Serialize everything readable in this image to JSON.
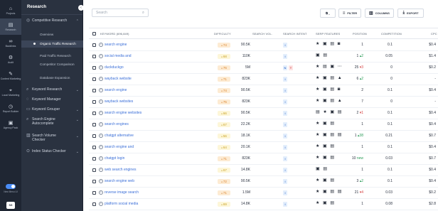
{
  "rail": [
    {
      "icon": "home-icon",
      "glyph": "⌂",
      "label": "Projects"
    },
    {
      "icon": "research-icon",
      "glyph": "▤",
      "label": "Research"
    },
    {
      "icon": "backlinks-icon",
      "glyph": "∞",
      "label": "Backlinks"
    },
    {
      "icon": "audit-icon",
      "glyph": "⚙",
      "label": "Audit"
    },
    {
      "icon": "content-icon",
      "glyph": "✎",
      "label": "Content Marketing"
    },
    {
      "icon": "local-icon",
      "glyph": "⌖",
      "label": "Local Marketing"
    },
    {
      "icon": "report-icon",
      "glyph": "◷",
      "label": "Report Builder"
    },
    {
      "icon": "agency-icon",
      "glyph": "▣",
      "label": "Agency Pack"
    }
  ],
  "rail_footer": {
    "toggle_label": "New Menu UI",
    "avatar": "SG"
  },
  "panel": {
    "title": "Research",
    "collapse_glyph": "‹",
    "sections": [
      {
        "label": "Competitive Research",
        "icon": "◎",
        "caret": "⌃"
      },
      {
        "label": "Keyword Research",
        "icon": "⌕",
        "caret": "⌄"
      },
      {
        "label": "Keyword Manager",
        "icon": "◌",
        "caret": ""
      },
      {
        "label": "Keyword Grouper",
        "icon": "▭",
        "caret": "⌄"
      },
      {
        "label": "Search Engine Autocomplete",
        "icon": "⌕",
        "caret": "⌄"
      },
      {
        "label": "Search Volume Checker",
        "icon": "▥",
        "caret": "⌄"
      },
      {
        "label": "Index Status Checker",
        "icon": "⊙",
        "caret": "⌄"
      }
    ],
    "sub_items": [
      "Overview",
      "Organic Traffic Research",
      "Paid Traffic Research",
      "Competitor Comparison",
      "Database Expansion"
    ]
  },
  "toolbar": {
    "search_placeholder": "Search",
    "filter_label": "FILTER",
    "columns_label": "COLUMNS",
    "export_label": "EXPORT",
    "copy_glyph": "⧉ ⌄"
  },
  "table": {
    "headers": {
      "keyword": "KEYWORD (696,849)",
      "difficulty": "DIFFICULTY",
      "search_vol": "SEARCH VOL.",
      "intent": "SEARCH INTENT",
      "serp": "SERP FEATURES",
      "position": "POSITION",
      "competition": "COMPETITION",
      "cpc": "CPC"
    },
    "rows": [
      {
        "keyword": "search engine",
        "difficulty": "74",
        "vol": "90.5K",
        "intents": [
          "I"
        ],
        "serp": "★ ▣ ▤ ◙",
        "position": "1",
        "competition": "0.1",
        "cpc": "$0.4"
      },
      {
        "keyword": "social media and",
        "difficulty": "68",
        "vol": "110K",
        "intents": [
          "I"
        ],
        "serp": "▣ ▤",
        "position": "1 ▴2",
        "competition": "0.05",
        "cpc": "$1.4"
      },
      {
        "keyword": "duckduckgo",
        "difficulty": "76",
        "vol": "5M",
        "intents": [
          "N",
          "T"
        ],
        "serp": "★ ▤ ▣ ⋯",
        "position": "25 ▾3",
        "competition": "0",
        "cpc": "$0.2"
      },
      {
        "keyword": "wayback website",
        "difficulty": "71",
        "vol": "823K",
        "intents": [
          "I"
        ],
        "serp": "★ ▣ ▤ ▲",
        "position": "6 ▴2",
        "competition": "0",
        "cpc": "-"
      },
      {
        "keyword": "search engine",
        "difficulty": "74",
        "vol": "90.5K",
        "intents": [
          "I"
        ],
        "serp": "★ ▣ ▤ ◙",
        "position": "2",
        "competition": "0.1",
        "cpc": "$0.4"
      },
      {
        "keyword": "wayback websites",
        "difficulty": "75",
        "vol": "823K",
        "intents": [
          "I"
        ],
        "serp": "★ ▣ ▤ ▲",
        "position": "7",
        "competition": "0",
        "cpc": "-"
      },
      {
        "keyword": "search engine websites",
        "difficulty": "66",
        "vol": "90.5K",
        "intents": [
          "I"
        ],
        "serp": "▤ ★ ▣ ▤",
        "position": "2 ▾1",
        "competition": "0.1",
        "cpc": "$0.4"
      },
      {
        "keyword": "search engines",
        "difficulty": "67",
        "vol": "22.2K",
        "intents": [
          "I"
        ],
        "serp": "★ ▣ ▤",
        "position": "1",
        "competition": "0.1",
        "cpc": "$0.4"
      },
      {
        "keyword": "chatgpt alternative",
        "difficulty": "56",
        "vol": "18.1K",
        "intents": [
          "I"
        ],
        "serp": "★ ▣ ▤ ▤",
        "position": "1 ▴38",
        "competition": "0.21",
        "cpc": "$0.7"
      },
      {
        "keyword": "search engine and",
        "difficulty": "64",
        "vol": "20.1K",
        "intents": [
          "I"
        ],
        "serp": "★ ▣ ▤",
        "position": "1",
        "competition": "0.1",
        "cpc": "$0.4"
      },
      {
        "keyword": "chatgpt login",
        "difficulty": "71",
        "vol": "823K",
        "intents": [
          "I"
        ],
        "serp": "★ ▣ ▤",
        "position": "10 new",
        "competition": "0.03",
        "cpc": "$0.7"
      },
      {
        "keyword": "web search engines",
        "difficulty": "67",
        "vol": "14.8K",
        "intents": [
          "I"
        ],
        "serp": "▣ ▤",
        "position": "1",
        "competition": "0.1",
        "cpc": "$0.4"
      },
      {
        "keyword": "search engine web",
        "difficulty": "72",
        "vol": "90.5K",
        "intents": [
          "I"
        ],
        "serp": "★ ▣ ▤",
        "position": "3 ▴2",
        "competition": "0.1",
        "cpc": "$0.4"
      },
      {
        "keyword": "reverse image search",
        "difficulty": "71",
        "vol": "1.5M",
        "intents": [
          "I"
        ],
        "serp": "★ ▣ ▤ ▤",
        "position": "21 ▾4",
        "competition": "0.03",
        "cpc": "$0.2"
      },
      {
        "keyword": "platform social media",
        "difficulty": "69",
        "vol": "14.8K",
        "intents": [
          "I"
        ],
        "serp": "★ ▣ ▤",
        "position": "1",
        "competition": "0.08",
        "cpc": "$2.8"
      }
    ]
  },
  "colors": {
    "diff_orange_bg": "#fdebd3",
    "diff_orange_fg": "#d9822b",
    "diff_yellow_bg": "#fdf6d8",
    "diff_yellow_fg": "#c9a227",
    "intent_i_bg": "#e3eefc",
    "intent_i_fg": "#4a7bd0",
    "intent_t_bg": "#fde4e4",
    "intent_t_fg": "#d64545",
    "link": "#3b6fd8"
  }
}
